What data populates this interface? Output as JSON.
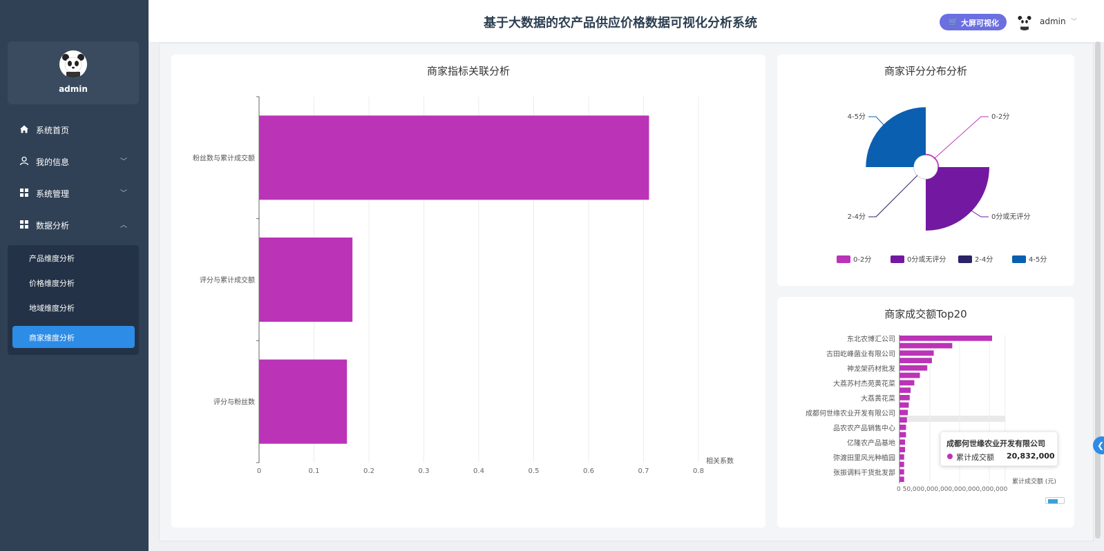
{
  "app": {
    "title": "基于大数据的农产品供应价格数据可视化分析系统",
    "bigscreen_label": "大屏可视化",
    "user": "admin"
  },
  "sidebar": {
    "username": "admin",
    "menu": [
      {
        "label": "系统首页",
        "icon": "home-icon"
      },
      {
        "label": "我的信息",
        "icon": "user-icon"
      },
      {
        "label": "系统管理",
        "icon": "grid-icon"
      },
      {
        "label": "数据分析",
        "icon": "grid-icon"
      }
    ],
    "submenu": [
      {
        "label": "产品维度分析"
      },
      {
        "label": "价格维度分析"
      },
      {
        "label": "地域维度分析"
      },
      {
        "label": "商家维度分析",
        "active": true
      }
    ]
  },
  "colors": {
    "accent": "#2d8ce6",
    "bar": "#bb33b7",
    "pie": [
      "#bb33b7",
      "#7319a1",
      "#2b2366",
      "#0b5fb0"
    ]
  },
  "chart_data": [
    {
      "type": "bar",
      "orientation": "horizontal",
      "title": "商家指标关联分析",
      "categories": [
        "粉丝数与累计成交额",
        "评分与累计成交额",
        "评分与粉丝数"
      ],
      "values": [
        0.71,
        0.17,
        0.16
      ],
      "xlabel": "相关系数",
      "xlim": [
        0,
        0.8
      ],
      "xticks": [
        "0",
        "0.1",
        "0.2",
        "0.3",
        "0.4",
        "0.5",
        "0.6",
        "0.7",
        "0.8"
      ],
      "grid": true
    },
    {
      "type": "pie",
      "subtype": "rose",
      "title": "商家评分分布分析",
      "labels": [
        "0-2分",
        "0分或无评分",
        "2-4分",
        "4-5分"
      ],
      "relative_sizes": [
        0.03,
        1.0,
        0.005,
        0.93
      ],
      "legend": "bottom"
    },
    {
      "type": "bar",
      "orientation": "horizontal",
      "title": "商家成交额Top20",
      "xlabel": "累计成交额 (元)",
      "xtick_text": "0 50,000,000,000,000,000,000,000",
      "category_labels": [
        "东北农博汇公司",
        "古田屹峰菌业有限公司",
        "神龙架药材批发",
        "大荔苏村杰苑黄花菜",
        "大荔黄花菜",
        "成都何世缘农业开发有限公司",
        "品农农产品销售中心",
        "亿隆农产品基地",
        "弥渡田里风光种植园",
        "张振调料干货批发部"
      ],
      "relative_values": [
        1.0,
        0.57,
        0.37,
        0.35,
        0.3,
        0.22,
        0.16,
        0.12,
        0.11,
        0.1,
        0.09,
        0.08,
        0.07,
        0.07,
        0.06,
        0.06,
        0.05,
        0.05,
        0.05,
        0.05
      ],
      "tooltip": {
        "title": "成都何世缘农业开发有限公司",
        "series": "累计成交额",
        "value": "20,832,000"
      }
    }
  ]
}
